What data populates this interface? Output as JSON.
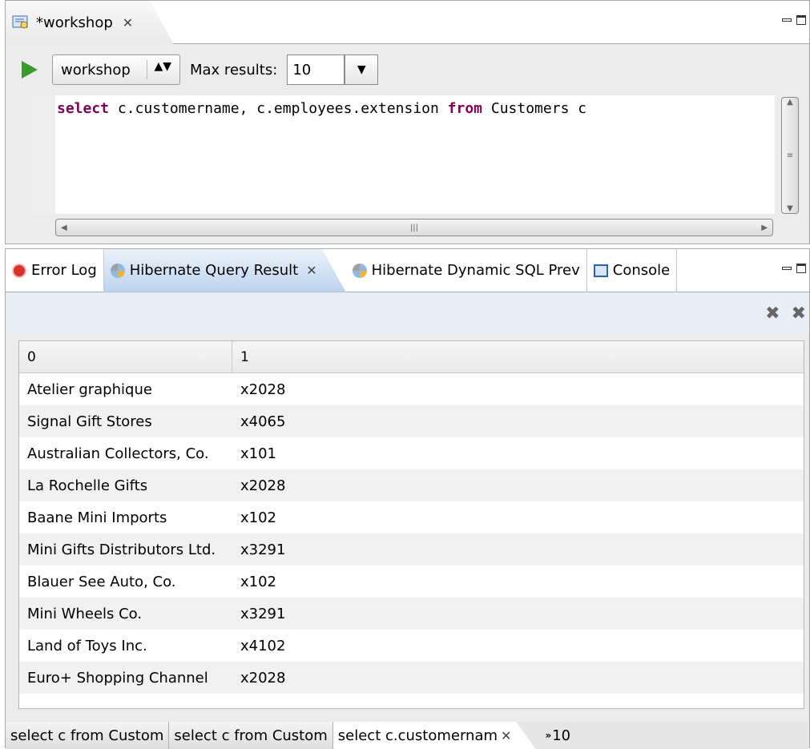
{
  "editor": {
    "tab_label": "*workshop",
    "tab_close": "✕",
    "config": "workshop",
    "max_results_label": "Max results:",
    "max_results_value": "10",
    "query": {
      "kw1": "select",
      "part1": " c.customername, c.employees.extension ",
      "kw2": "from",
      "part2": " Customers c"
    }
  },
  "views": {
    "tabs": [
      {
        "label": "Error Log",
        "icon": "error-log-icon"
      },
      {
        "label": "Hibernate Query Result",
        "icon": "hibernate-icon",
        "active": true
      },
      {
        "label": "Hibernate Dynamic SQL Prev",
        "icon": "hibernate-icon"
      },
      {
        "label": "Console",
        "icon": "console-icon"
      }
    ],
    "close": "✕"
  },
  "result": {
    "columns": [
      "0",
      "1"
    ],
    "rows": [
      [
        "Atelier graphique",
        "x2028"
      ],
      [
        "Signal Gift Stores",
        "x4065"
      ],
      [
        "Australian Collectors, Co.",
        "x101"
      ],
      [
        "La Rochelle Gifts",
        "x2028"
      ],
      [
        "Baane Mini Imports",
        "x102"
      ],
      [
        "Mini Gifts Distributors Ltd.",
        "x3291"
      ],
      [
        "Blauer See Auto, Co.",
        "x102"
      ],
      [
        "Mini Wheels Co.",
        "x3291"
      ],
      [
        "Land of Toys Inc.",
        "x4102"
      ],
      [
        "Euro+ Shopping Channel",
        "x2028"
      ]
    ]
  },
  "bottom_tabs": {
    "tabs": [
      "select c from Custom",
      "select c from Custom",
      "select c.customernam"
    ],
    "close": "✕",
    "overflow_marker": "»",
    "overflow_count": "10"
  },
  "colors": {
    "keyword": "#7f0055",
    "active_tab": "#bcd3ee",
    "run": "#3a9a2e"
  }
}
